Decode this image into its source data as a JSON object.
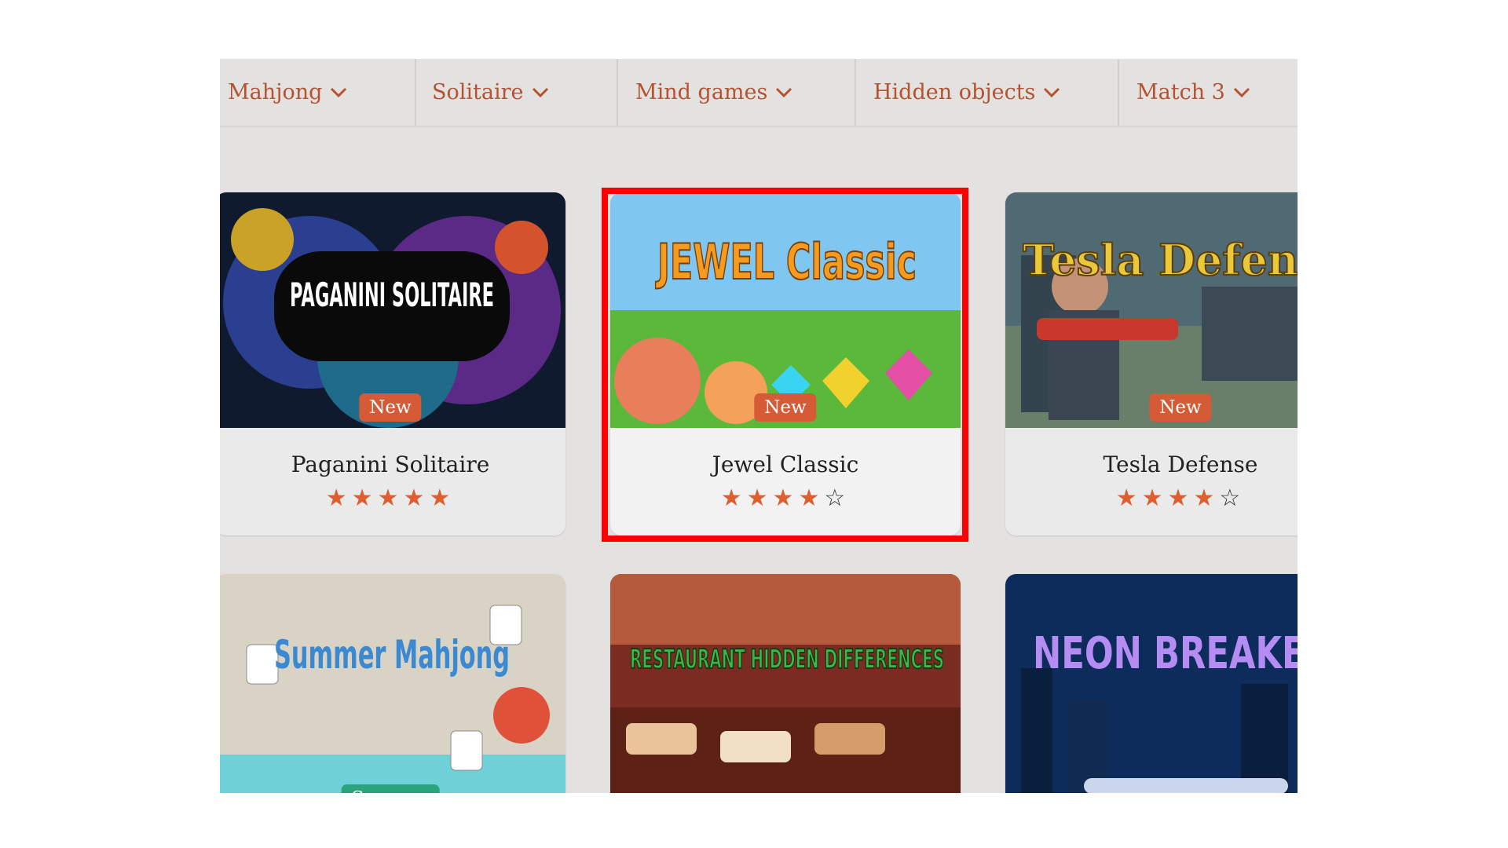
{
  "nav": {
    "items": [
      {
        "label": "Mahjong"
      },
      {
        "label": "Solitaire"
      },
      {
        "label": "Mind games"
      },
      {
        "label": "Hidden objects"
      },
      {
        "label": "Match 3"
      }
    ]
  },
  "cards": [
    {
      "title": "Paganini Solitaire",
      "badge": "New",
      "rating": 5,
      "art_text": "PAGANINI SOLITAIRE"
    },
    {
      "title": "Jewel Classic",
      "badge": "New",
      "rating": 4,
      "art_text": "JEWEL Classic"
    },
    {
      "title": "Tesla Defense",
      "badge": "New",
      "rating": 4,
      "art_text": "Tesla Defense"
    },
    {
      "title": "",
      "badge": "Summer",
      "art_text": "Summer Mahjong"
    },
    {
      "title": "",
      "art_text": "RESTAURANT HIDDEN DIFFERENCES"
    },
    {
      "title": "",
      "art_text": "NEON BREAKER"
    }
  ],
  "colors": {
    "accent": "#b5522f",
    "star": "#de5e2f",
    "highlight": "#ff0000",
    "badge_new": "#d55a36",
    "badge_summer": "#2aa37a"
  }
}
